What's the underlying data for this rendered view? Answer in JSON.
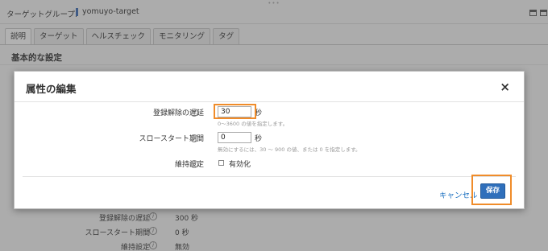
{
  "header": {
    "target_group_label": "ターゲットグループ:",
    "target_group_name": "yomuyo-target"
  },
  "tabs": [
    {
      "label": "説明",
      "active": true
    },
    {
      "label": "ターゲット",
      "active": false
    },
    {
      "label": "ヘルスチェック",
      "active": false
    },
    {
      "label": "モニタリング",
      "active": false
    },
    {
      "label": "タグ",
      "active": false
    }
  ],
  "section": {
    "title": "基本的な設定"
  },
  "background_attributes": [
    {
      "label": "登録解除の遅延",
      "value": "300 秒"
    },
    {
      "label": "スロースタート期間",
      "value": "0 秒"
    },
    {
      "label": "維持設定",
      "value": "無効"
    }
  ],
  "modal": {
    "title": "属性の編集",
    "close_symbol": "×",
    "fields": {
      "deregistration_delay": {
        "label": "登録解除の遅延",
        "value": "30",
        "unit": "秒",
        "hint": "0～3600 の値を指定します。"
      },
      "slow_start": {
        "label": "スロースタート期間",
        "value": "0",
        "unit": "秒",
        "hint": "無効にするには、30 ～ 900 の値、または 0 を指定します。"
      },
      "stickiness": {
        "label": "維持設定",
        "checkbox_label": "有効化",
        "checked": false
      }
    },
    "cancel_label": "キャンセル",
    "save_label": "保存"
  },
  "colors": {
    "highlight": "#f08c2a",
    "primary_button": "#2f6fbb",
    "link": "#1a6fc0"
  }
}
